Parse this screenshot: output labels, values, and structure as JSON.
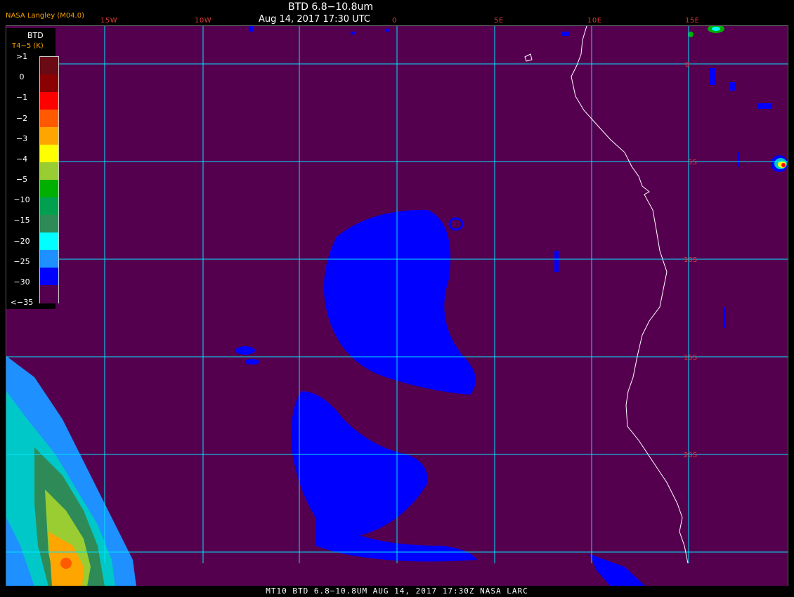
{
  "header": {
    "title": "BTD 6.8−10.8um",
    "timestamp": "Aug 14, 2017 17:30 UTC",
    "credit": "NASA Langley (M04.0)"
  },
  "axes": {
    "lon_labels": [
      "15W",
      "10W",
      "0",
      "5E",
      "10E",
      "15E"
    ],
    "lat_labels": [
      "0",
      "5S",
      "10S",
      "15S",
      "20S"
    ]
  },
  "legend": {
    "title": "BTD",
    "unit": "T4−5 (K)",
    "ticks": [
      ">1",
      "0",
      "−1",
      "−2",
      "−3",
      "−4",
      "−5",
      "−10",
      "−15",
      "−20",
      "−25",
      "−30",
      "<−35"
    ],
    "colors": [
      "#6a0a14",
      "#8b0000",
      "#ff0000",
      "#ff5a00",
      "#ffa500",
      "#ffff00",
      "#9acd32",
      "#00b000",
      "#00a050",
      "#2e8b57",
      "#00ffff",
      "#1e90ff",
      "#0000ff",
      "#55004f"
    ]
  },
  "colors": {
    "background": "#55004f",
    "grid": "#00e5ff",
    "coastline": "#ffffff",
    "label": "#e23a3a",
    "credit": "#f2a000"
  },
  "footer": {
    "text": "MT10  BTD 6.8−10.8UM  AUG 14, 2017 17:30Z  NASA LARC"
  }
}
